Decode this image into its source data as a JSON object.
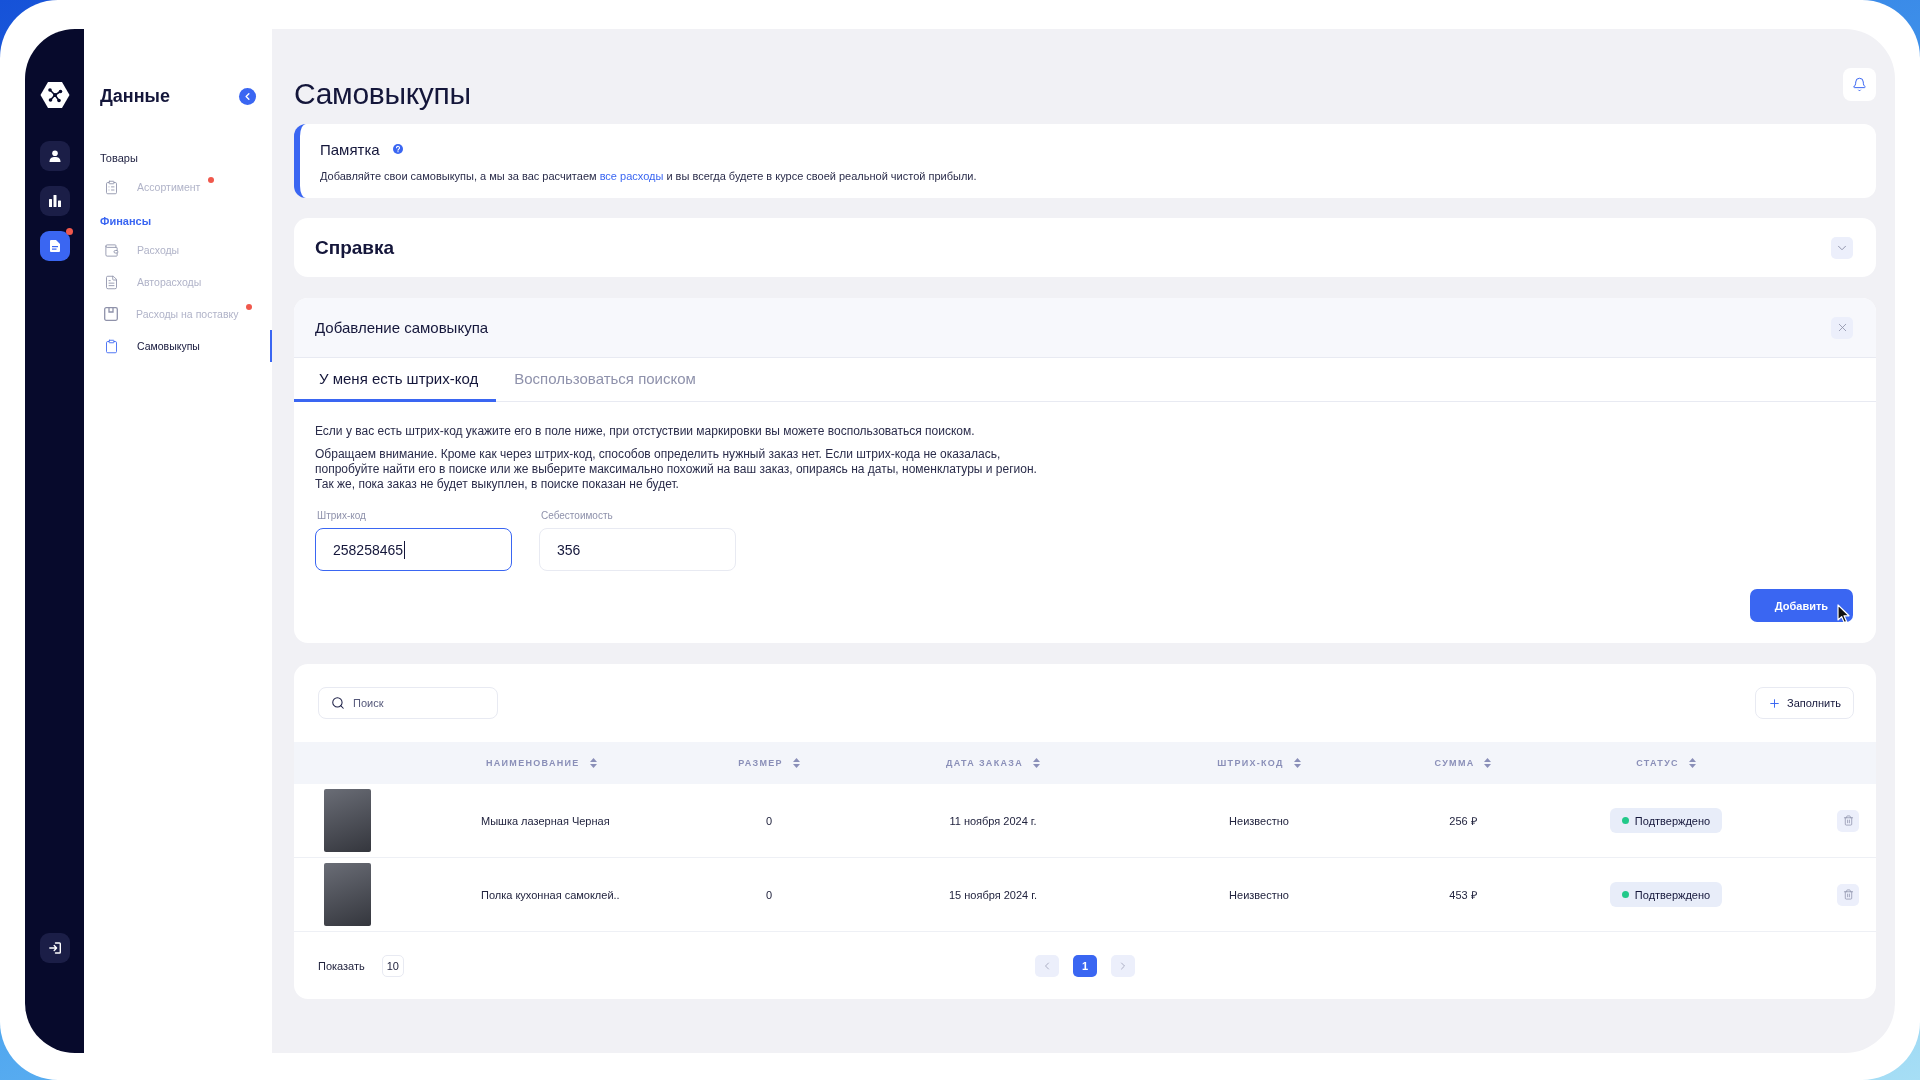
{
  "rail": {
    "items": [
      {
        "selected": false,
        "notification": false
      },
      {
        "selected": false,
        "notification": false
      },
      {
        "selected": true,
        "notification": true
      }
    ]
  },
  "sidebar": {
    "title": "Данные",
    "sections": [
      {
        "label": "Товары",
        "active": false,
        "items": [
          {
            "label": "Ассортимент",
            "selected": false,
            "notification": true
          }
        ]
      },
      {
        "label": "Финансы",
        "active": true,
        "items": [
          {
            "label": "Расходы",
            "selected": false,
            "notification": false
          },
          {
            "label": "Авторасходы",
            "selected": false,
            "notification": false
          },
          {
            "label": "Расходы на поставку",
            "selected": false,
            "notification": true
          },
          {
            "label": "Самовыкупы",
            "selected": true,
            "notification": false
          }
        ]
      }
    ]
  },
  "page": {
    "title": "Самовыкупы"
  },
  "memo": {
    "title": "Памятка",
    "text_before": "Добавляйте свои самовыкупы, а мы за вас расчитаем ",
    "link": "все расходы",
    "text_after": " и вы всегда будете в курсе своей реальной чистой прибыли."
  },
  "help": {
    "title": "Справка",
    "expanded": false
  },
  "add_form": {
    "title": "Добавление самовыкупа",
    "tabs": [
      {
        "label": "У меня есть штрих-код",
        "selected": true
      },
      {
        "label": "Воспользоваться поиском",
        "selected": false
      }
    ],
    "notes": [
      {
        "lines": [
          "Если у вас есть штрих-код укажите его в поле ниже, при отстуствии маркировки вы можете воспользоваться поиском."
        ]
      },
      {
        "lines": [
          "Обращаем внимание. Кроме как через штрих-код, способов определить нужный заказ нет. Если штрих-кода не оказалась,",
          "попробуйте найти его в поиске или же выберите максимально похожий на ваш заказ, опираясь на даты, номенклатуры и регион.",
          "Так же, пока заказ не будет выкуплен, в поиске показан не будет."
        ]
      }
    ],
    "fields": [
      {
        "label": "Штрих-код",
        "value": "258258465",
        "focused": true
      },
      {
        "label": "Себестоимость",
        "value": "356",
        "focused": false
      }
    ],
    "submit": "Добавить"
  },
  "purchases": {
    "search": {
      "placeholder": "Поиск"
    },
    "fill_button": "Заполнить",
    "columns": [
      {
        "label": "НАИМЕНОВАНИЕ"
      },
      {
        "label": "РАЗМЕР"
      },
      {
        "label": "ДАТА ЗАКАЗА"
      },
      {
        "label": "ШТРИХ-КОД"
      },
      {
        "label": "СУММА"
      },
      {
        "label": "СТАТУС"
      }
    ],
    "rows": [
      {
        "name": "Мышка лазерная Черная",
        "size": "0",
        "date": "11 ноября 2024 г.",
        "barcode": "Неизвестно",
        "sum": "256 ₽",
        "status": {
          "label": "Подтверждено",
          "color": "#22c98a"
        }
      },
      {
        "name": "Полка кухонная самоклей..",
        "size": "0",
        "date": "15 ноября 2024 г.",
        "barcode": "Неизвестно",
        "sum": "453 ₽",
        "status": {
          "label": "Подтверждено",
          "color": "#22c98a"
        }
      }
    ],
    "page_size": {
      "label": "Показать",
      "value": "10"
    },
    "pages": [
      {
        "label": "1",
        "selected": true
      }
    ]
  }
}
